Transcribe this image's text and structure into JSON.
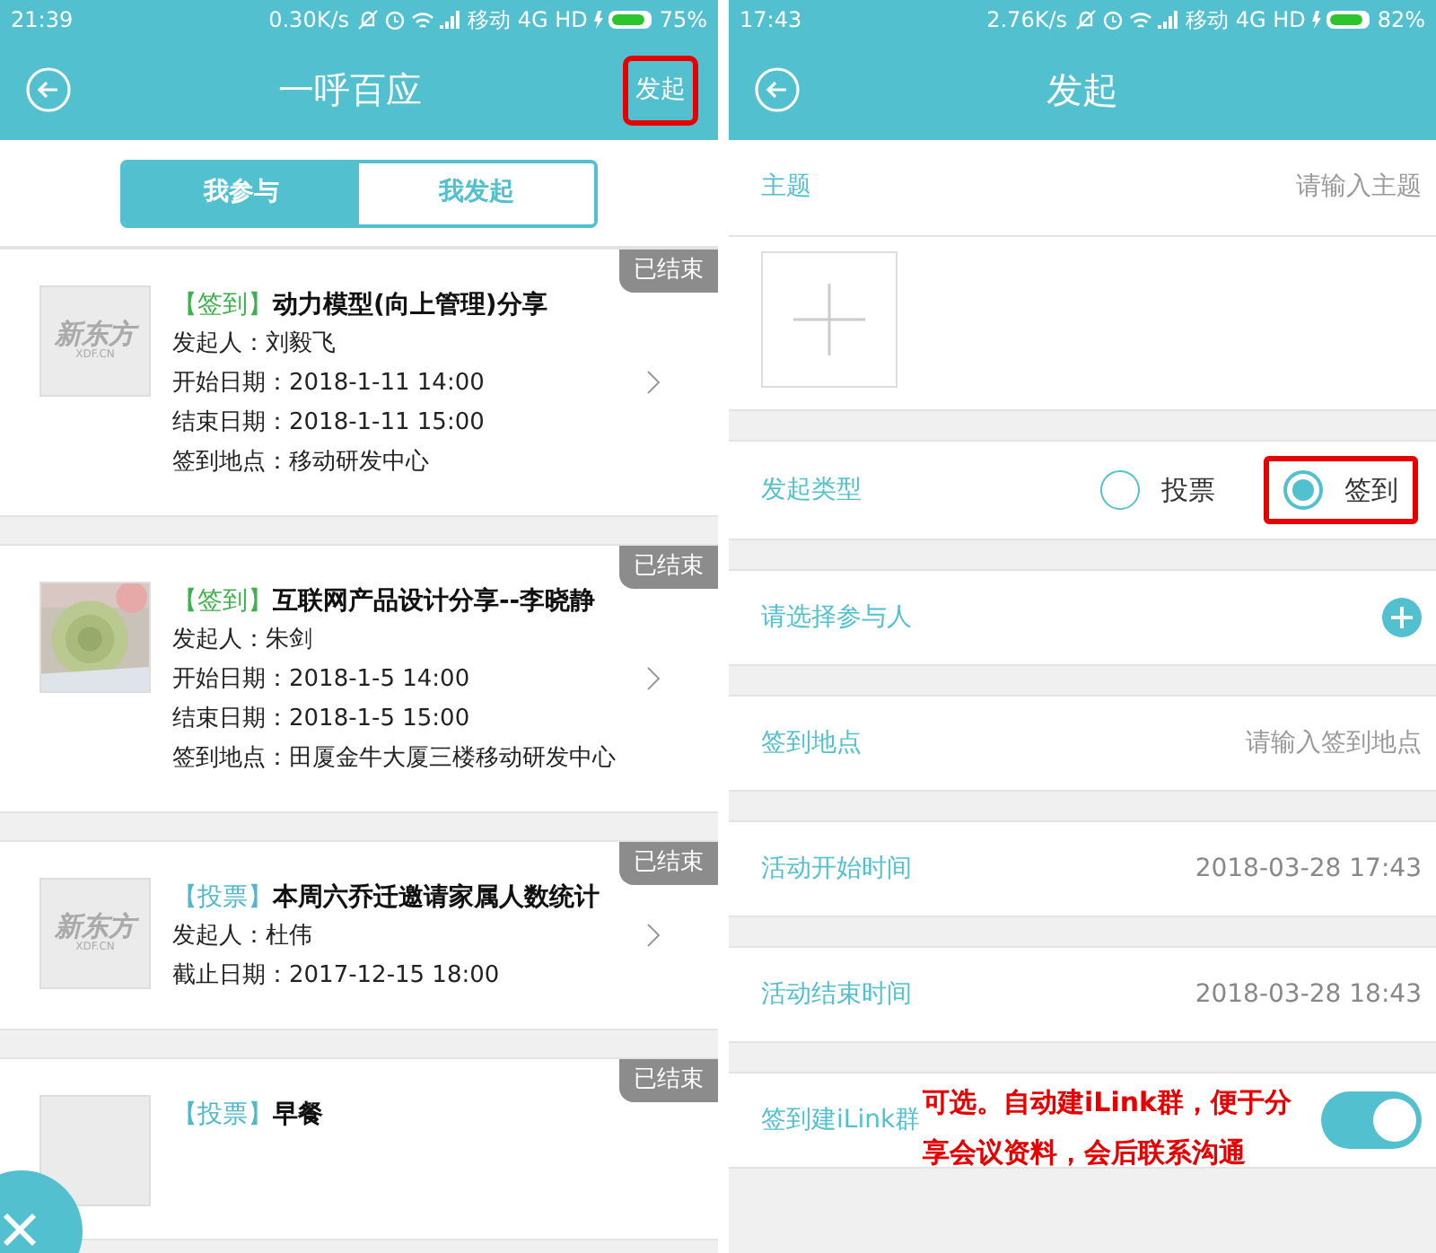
{
  "left": {
    "status_bar": {
      "time": "21:39",
      "speed": "0.30K/s",
      "carrier": "移动 4G HD",
      "battery": "75%"
    },
    "header": {
      "title": "一呼百应",
      "action": {
        "label": "发起",
        "highlighted": true
      }
    },
    "tabs": [
      {
        "label": "我参与",
        "selected": true
      },
      {
        "label": "我发起",
        "selected": false
      }
    ],
    "cards": [
      {
        "status": "已结束",
        "thumbnail": {
          "kind": "logo",
          "text": "新东方",
          "subtext": "XDF.CN"
        },
        "tag": {
          "text": "【签到】",
          "color": "#3cb34a"
        },
        "title": "动力模型(向上管理)分享",
        "lines": [
          "发起人：刘毅飞",
          "开始日期：2018-1-11 14:00",
          "结束日期：2018-1-11 15:00",
          "签到地点：移动研发中心"
        ]
      },
      {
        "status": "已结束",
        "tag": {
          "text": "【签到】",
          "color": "#3cb34a"
        },
        "title": "互联网产品设计分享--李晓静",
        "lines": [
          "发起人：朱剑",
          "开始日期：2018-1-5 14:00",
          "结束日期：2018-1-5 15:00",
          "签到地点：田厦金牛大厦三楼移动研发中心"
        ]
      },
      {
        "status": "已结束",
        "thumbnail": {
          "kind": "logo",
          "text": "新东方",
          "subtext": "XDF.CN"
        },
        "tag": {
          "text": "【投票】",
          "color": "#4fb8c9"
        },
        "title": "本周六乔迁邀请家属人数统计",
        "lines": [
          "发起人：杜伟",
          "截止日期：2017-12-15 18:00"
        ]
      },
      {
        "status": "已结束",
        "thumbnail": {
          "kind": "logo"
        },
        "tag": {
          "text": "【投票】",
          "color": "#4fb8c9"
        },
        "title": "早餐"
      }
    ]
  },
  "right": {
    "status_bar": {
      "time": "17:43",
      "speed": "2.76K/s",
      "carrier": "移动 4G HD",
      "battery": "82%"
    },
    "header": {
      "title": "发起"
    },
    "form": [
      {
        "kind": "input",
        "label": "主题",
        "placeholder": "请输入主题"
      },
      {
        "kind": "image_add"
      },
      {
        "kind": "radio",
        "label": "发起类型",
        "options": [
          {
            "label": "投票",
            "selected": false,
            "highlighted": false
          },
          {
            "label": "签到",
            "selected": true,
            "highlighted": true
          }
        ]
      },
      {
        "kind": "add",
        "label": "请选择参与人"
      },
      {
        "kind": "input",
        "label": "签到地点",
        "placeholder": "请输入签到地点"
      },
      {
        "kind": "value",
        "label": "活动开始时间",
        "value": "2018-03-28 17:43"
      },
      {
        "kind": "value",
        "label": "活动结束时间",
        "value": "2018-03-28 18:43"
      },
      {
        "kind": "toggle",
        "label": "签到建iLink群",
        "on": true,
        "note": "可选。自动建iLink群，便于分享会议资料，会后联系沟通"
      }
    ]
  }
}
